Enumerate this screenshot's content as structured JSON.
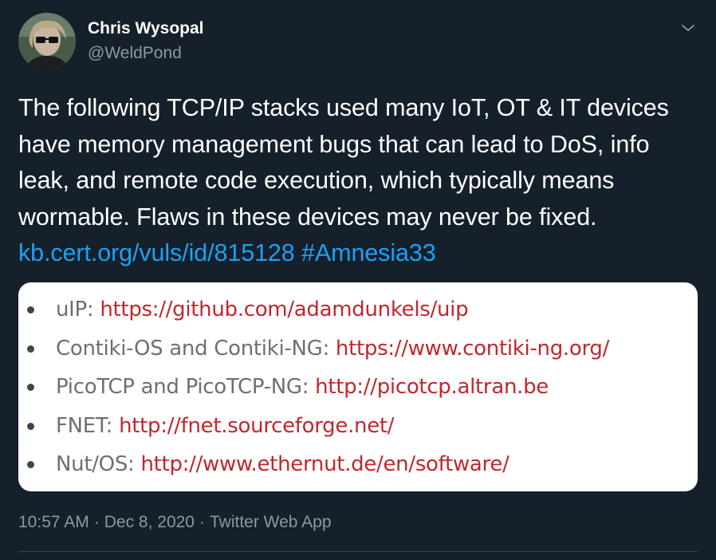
{
  "author": {
    "display_name": "Chris Wysopal",
    "handle": "@WeldPond",
    "avatar_icon": "user-avatar"
  },
  "tweet": {
    "text": "The following TCP/IP stacks used many IoT, OT & IT devices have memory management bugs that can lead to DoS, info leak, and remote code execution, which typically means wormable. Flaws in these devices may never be fixed.",
    "link": "kb.cert.org/vuls/id/815128",
    "hashtag": "#Amnesia33"
  },
  "media": {
    "items": [
      {
        "label": "uIP: ",
        "url": "https://github.com/adamdunkels/uip"
      },
      {
        "label": "Contiki-OS and Contiki-NG: ",
        "url": "https://www.contiki-ng.org/"
      },
      {
        "label": "PicoTCP and PicoTCP-NG: ",
        "url": "http://picotcp.altran.be"
      },
      {
        "label": "FNET: ",
        "url": "http://fnet.sourceforge.net/"
      },
      {
        "label": "Nut/OS: ",
        "url": "http://www.ethernut.de/en/software/"
      }
    ]
  },
  "meta": {
    "time": "10:57 AM",
    "separator": "·",
    "date": "Dec 8, 2020",
    "source": "Twitter Web App"
  },
  "colors": {
    "background": "#15202b",
    "link": "#1da1f2",
    "secondary_text": "#8899a6",
    "list_url": "#c1272d"
  },
  "icons": {
    "more": "chevron-down-icon"
  }
}
